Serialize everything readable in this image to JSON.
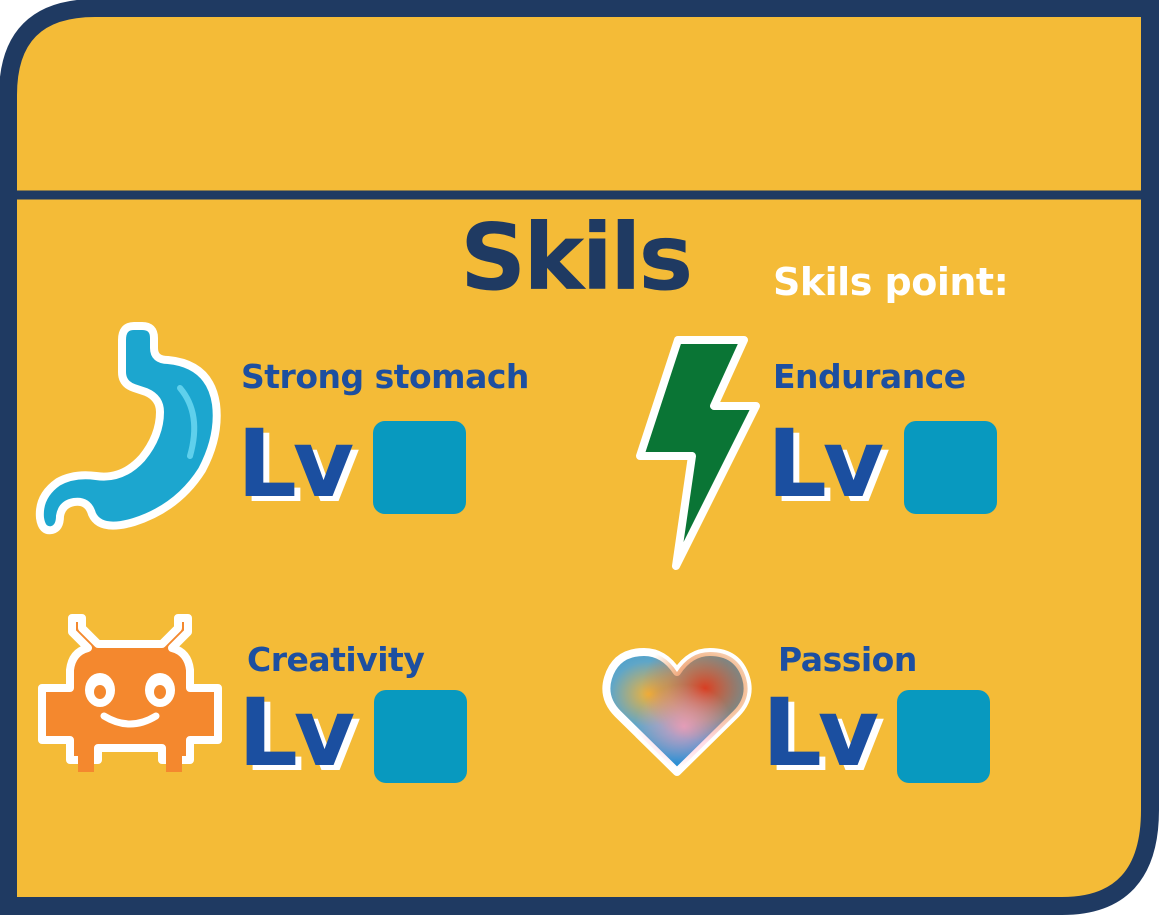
{
  "panel": {
    "title": "Skils",
    "points_label": "Skils point:"
  },
  "skills": [
    {
      "name": "Strong stomach",
      "lv_label": "Lv",
      "icon": "stomach-icon"
    },
    {
      "name": "Endurance",
      "lv_label": "Lv",
      "icon": "lightning-bolt-icon"
    },
    {
      "name": "Creativity",
      "lv_label": "Lv",
      "icon": "robot-invader-icon"
    },
    {
      "name": "Passion",
      "lv_label": "Lv",
      "icon": "heart-icon"
    }
  ],
  "colors": {
    "frame": "#1f3a62",
    "fill": "#f4bb37",
    "title": "#1f3a62",
    "skill_text": "#1d4fa0",
    "level_box": "#0899bf",
    "bolt": "#0a7535",
    "robot": "#f4882e",
    "stomach": "#1ca6cf"
  }
}
